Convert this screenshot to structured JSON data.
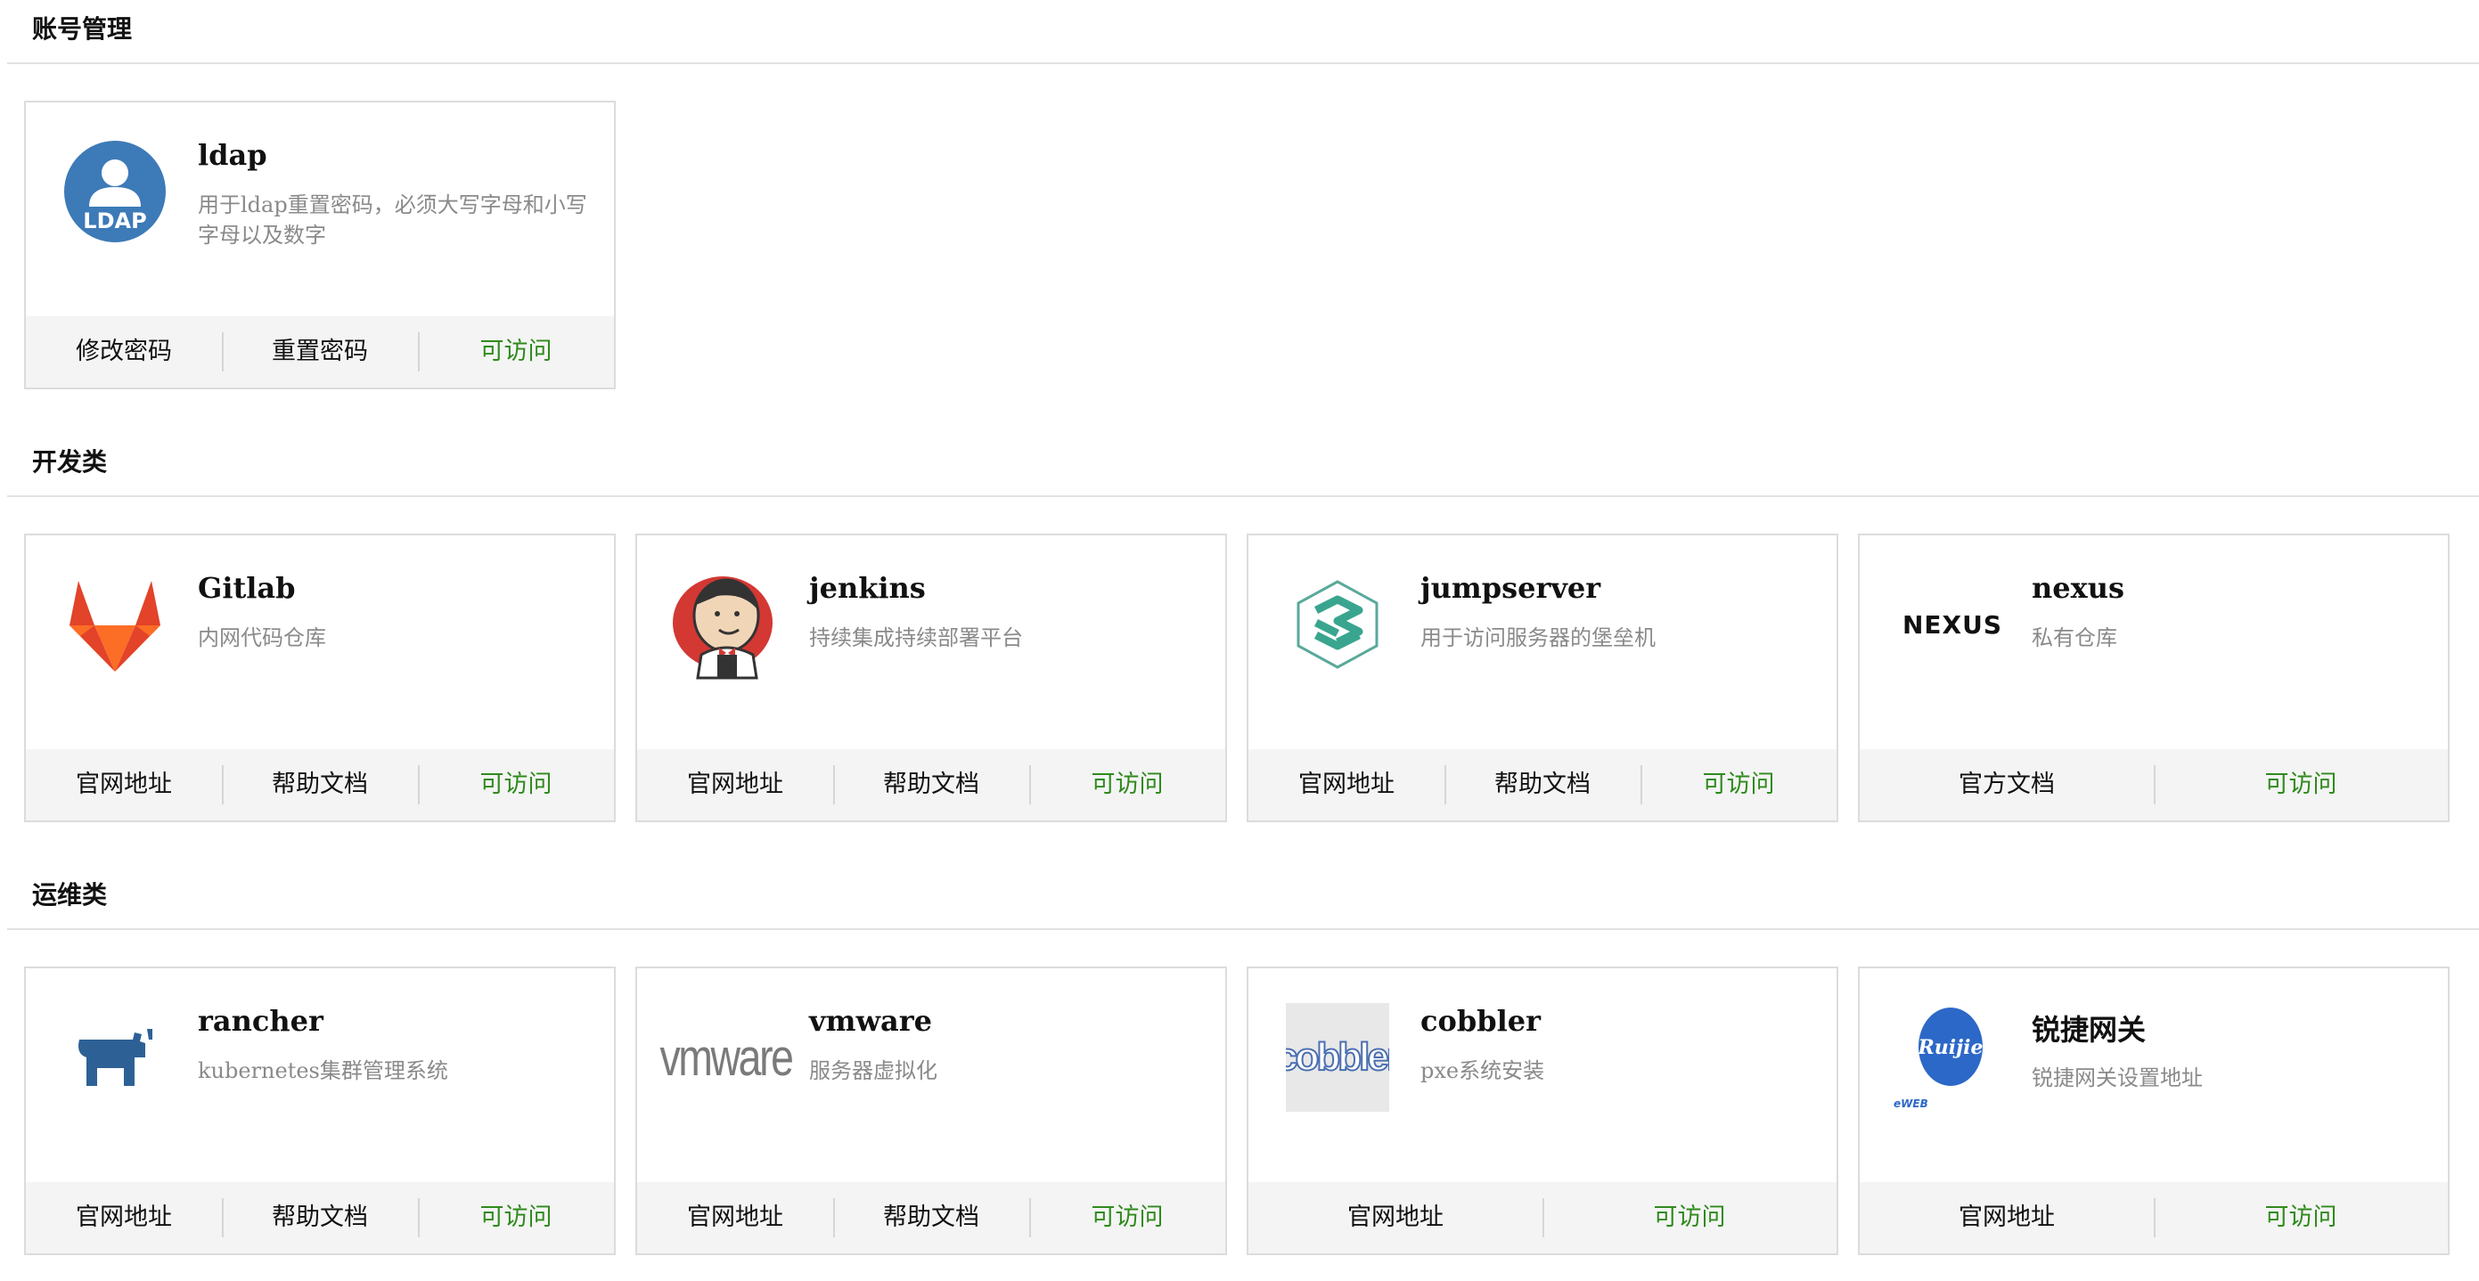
{
  "sections": [
    {
      "title": "账号管理",
      "cards": [
        {
          "name": "ldap",
          "desc": "用于ldap重置密码，必须大写字母和小写字母以及数字",
          "logo": "ldap-logo",
          "actions": [
            "修改密码",
            "重置密码"
          ],
          "status": "可访问"
        }
      ]
    },
    {
      "title": "开发类",
      "cards": [
        {
          "name": "Gitlab",
          "desc": "内网代码仓库",
          "logo": "gitlab-logo",
          "actions": [
            "官网地址",
            "帮助文档"
          ],
          "status": "可访问"
        },
        {
          "name": "jenkins",
          "desc": "持续集成持续部署平台",
          "logo": "jenkins-logo",
          "actions": [
            "官网地址",
            "帮助文档"
          ],
          "status": "可访问"
        },
        {
          "name": "jumpserver",
          "desc": "用于访问服务器的堡垒机",
          "logo": "jumpserver-logo",
          "actions": [
            "官网地址",
            "帮助文档"
          ],
          "status": "可访问"
        },
        {
          "name": "nexus",
          "desc": "私有仓库",
          "logo": "nexus-logo",
          "logo_text": "NEXUS",
          "actions": [
            "官方文档"
          ],
          "status": "可访问"
        }
      ]
    },
    {
      "title": "运维类",
      "cards": [
        {
          "name": "rancher",
          "desc": "kubernetes集群管理系统",
          "logo": "rancher-logo",
          "actions": [
            "官网地址",
            "帮助文档"
          ],
          "status": "可访问"
        },
        {
          "name": "vmware",
          "desc": "服务器虚拟化",
          "logo": "vmware-logo",
          "logo_text": "vmware",
          "actions": [
            "官网地址",
            "帮助文档"
          ],
          "status": "可访问"
        },
        {
          "name": "cobbler",
          "desc": "pxe系统安装",
          "logo": "cobbler-logo",
          "logo_text": "cobbler",
          "actions": [
            "官网地址"
          ],
          "status": "可访问"
        },
        {
          "name": "锐捷网关",
          "desc": "锐捷网关设置地址",
          "logo": "ruijie-logo",
          "logo_text": "Ruijie",
          "logo_subtext": "eWEB",
          "actions": [
            "官网地址"
          ],
          "status": "可访问"
        }
      ]
    }
  ],
  "colors": {
    "status_green": "#2f8a1c",
    "desc_gray": "#8a8a8a",
    "footer_bg": "#f4f4f4",
    "border": "#dcdcdc"
  }
}
